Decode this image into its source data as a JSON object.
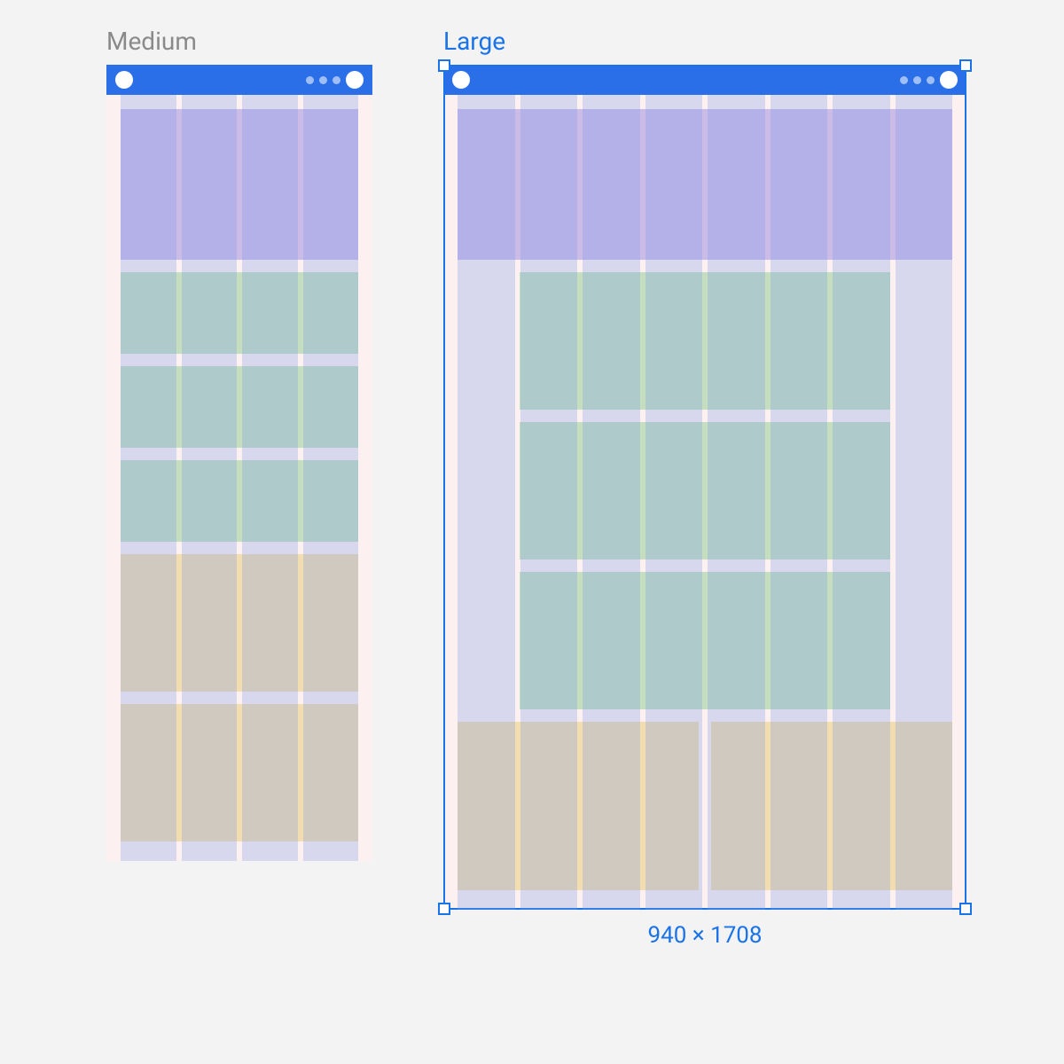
{
  "labels": {
    "medium": "Medium",
    "large": "Large"
  },
  "selection": {
    "dimensions_label": "940 × 1708"
  },
  "grid": {
    "medium_columns": 4,
    "large_columns": 8
  },
  "colors": {
    "appbar": "#2b6fe8",
    "selection": "#1a73e8",
    "purple_block": "#cbbce7",
    "green_block": "#c5dec0",
    "amber_block": "#f1ddaf",
    "body_bg": "#fdf0f0",
    "column_overlay": "rgba(120,150,235,0.28)"
  },
  "blocks": {
    "medium": [
      "purple",
      "green",
      "green",
      "green",
      "amber",
      "amber"
    ],
    "large": [
      "purple",
      "green",
      "green",
      "green",
      "amber-pair"
    ]
  }
}
